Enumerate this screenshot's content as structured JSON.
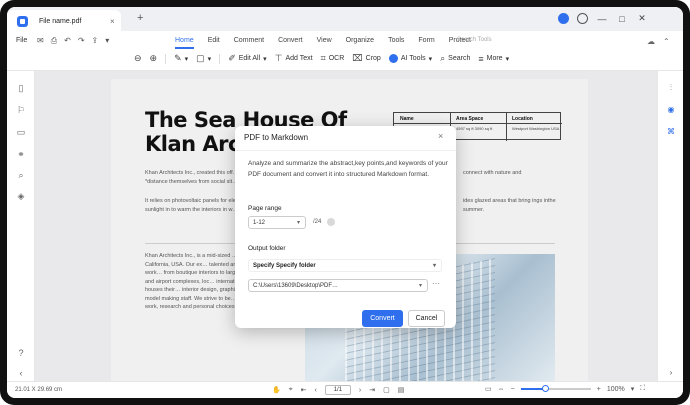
{
  "titlebar": {
    "tab_title": "File name.pdf",
    "tab_close": "×",
    "tab_add": "+",
    "window_controls": [
      "—",
      "□",
      "✕"
    ]
  },
  "menubar": {
    "file_label": "File",
    "menus": [
      "Home",
      "Edit",
      "Comment",
      "Convert",
      "View",
      "Organize",
      "Tools",
      "Form",
      "Protect"
    ],
    "active_menu": "Home",
    "search_placeholder": "Search Tools"
  },
  "toolbar": {
    "edit_all": "Edit All",
    "add_text": "Add Text",
    "ocr": "OCR",
    "crop": "Crop",
    "ai_tools": "AI Tools",
    "search": "Search",
    "more": "More"
  },
  "document": {
    "title_line1": "The Sea House Of",
    "title_line2": "Klan Arc",
    "table": {
      "headers": [
        "Name",
        "Area Space",
        "Location"
      ],
      "cells": [
        "The Sea House Of Klan Architecture",
        "4597 sq ft 3090 sq ft",
        "Westport Washington USA"
      ]
    },
    "para1": "Khan Architects Inc., created this off… *distance themselves from social sit…",
    "para2": "It relies on photovoltaic panels for ele… sunlight in to warm the interiors in w…",
    "para_r1": "connect with nature and",
    "para_r2": "ides glazed areas that bring ings inthe summer.",
    "para3": "Khan Architects Inc., is a mid-sized … firm based in California, USA. Our ex… talented and experienced staff work… from boutique interiors to large insti… buildings and airport complexes, loc… internationally. Our firm houses their… interior design, graphic design, landsc… model making staff. We strive to be… community through work, research and personal choices."
  },
  "dialog": {
    "title": "PDF to Markdown",
    "close": "×",
    "description": "Analyze and summarize the abstract,key points,and keywords of your PDF document and convert it into structured Markdown format.",
    "page_range_label": "Page range",
    "page_range_value": "1-12",
    "page_total": "/24",
    "output_folder_label": "Output folder",
    "output_folder_value": "Specify Specify folder",
    "path_value": "C:\\Users\\13609\\Desktop\\PDF…",
    "more": "···",
    "convert_label": "Convert",
    "cancel_label": "Cancel"
  },
  "statusbar": {
    "dimensions": "21.01 X 29.69 cm",
    "page_value": "1/1",
    "zoom_level": "100%",
    "zoom_fraction": 0.35
  },
  "colors": {
    "accent": "#2f6fed",
    "doc_background": "#e9e9ec"
  }
}
